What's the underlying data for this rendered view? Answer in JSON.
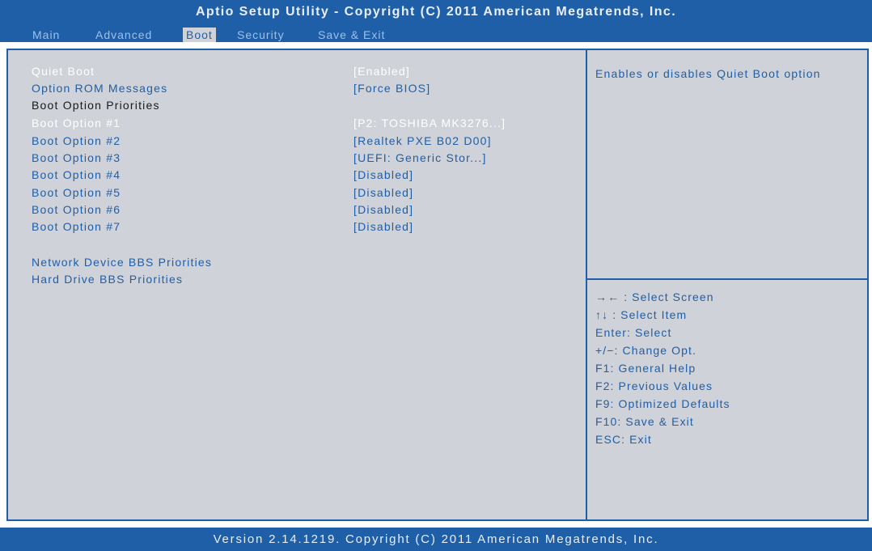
{
  "header": {
    "title": "Aptio Setup Utility - Copyright (C) 2011 American Megatrends, Inc.",
    "tabs": [
      {
        "label": "Main"
      },
      {
        "label": "Advanced"
      },
      {
        "label": "Boot"
      },
      {
        "label": "Security"
      },
      {
        "label": "Save & Exit"
      }
    ],
    "active_tab": "Boot"
  },
  "settings": [
    {
      "label": "Quiet Boot",
      "value": "[Enabled]"
    },
    {
      "label": "Option ROM Messages",
      "value": "[Force BIOS]"
    },
    {
      "label": "Boot Option Priorities",
      "value": ""
    },
    {
      "label": "Boot Option #1",
      "value": "[P2: TOSHIBA MK3276...]"
    },
    {
      "label": "Boot Option #2",
      "value": "[Realtek PXE B02 D00]"
    },
    {
      "label": "Boot Option #3",
      "value": "[UEFI: Generic Stor...]"
    },
    {
      "label": "Boot Option #4",
      "value": "[Disabled]"
    },
    {
      "label": "Boot Option #5",
      "value": "[Disabled]"
    },
    {
      "label": "Boot Option #6",
      "value": "[Disabled]"
    },
    {
      "label": "Boot Option #7",
      "value": "[Disabled]"
    },
    {
      "label": "Network Device BBS Priorities",
      "value": ""
    },
    {
      "label": "Hard Drive BBS Priorities",
      "value": ""
    }
  ],
  "help": {
    "text": "Enables or disables Quiet Boot option"
  },
  "keys": [
    "→← : Select Screen",
    "↑↓ : Select Item",
    "Enter: Select",
    "+/−: Change Opt.",
    "F1: General Help",
    "F2: Previous Values",
    "F9: Optimized Defaults",
    "F10: Save & Exit",
    "ESC: Exit"
  ],
  "footer": {
    "text": "Version 2.14.1219. Copyright (C) 2011 American Megatrends, Inc."
  },
  "colors": {
    "accent": "#1f5fa8",
    "panel": "#cfd2d8",
    "selected_text": "#ffffff",
    "header_text": "#1a1a1a"
  }
}
